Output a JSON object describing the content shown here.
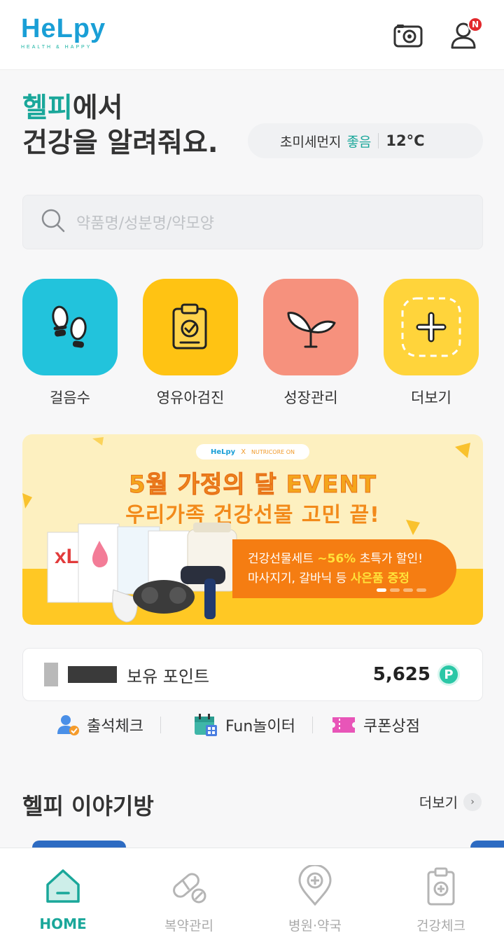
{
  "header": {
    "logo_text": "HeLpy",
    "logo_sub": "HEALTH & HAPPY",
    "icons": [
      "camera-icon",
      "user-icon"
    ],
    "notification_badge": "N"
  },
  "hero": {
    "line1_highlight": "헬피",
    "line1_rest": "에서",
    "line2": "건강을 알려줘요."
  },
  "weather": {
    "label": "초미세먼지",
    "status": "좋음",
    "temperature": "12°C"
  },
  "search": {
    "placeholder": "약품명/성분명/약모양"
  },
  "quick_menu": [
    {
      "label": "걸음수",
      "icon": "footprints-icon",
      "color": "#22c3dc"
    },
    {
      "label": "영유아검진",
      "icon": "clipboard-check-icon",
      "color": "#ffc313"
    },
    {
      "label": "성장관리",
      "icon": "sprout-icon",
      "color": "#f6917d"
    },
    {
      "label": "더보기",
      "icon": "plus-icon",
      "color": "#ffd43b"
    }
  ],
  "banner": {
    "logo_left": "HeLpy",
    "logo_x": "X",
    "logo_right": "NUTRICORE ON",
    "title1": "5월 가정의 달 EVENT",
    "title2": "우리가족 건강선물 고민 끝!",
    "pill_line1_a": "건강선물세트 ",
    "pill_line1_b": "~56%",
    "pill_line1_c": " 초특가 할인!",
    "pill_line2_a": "마사지기, 갈바닉 등 ",
    "pill_line2_b": "사은품 증정",
    "page_dots": 4,
    "active_dot": 0
  },
  "points": {
    "label": "보유 포인트",
    "value": "5,625",
    "badge": "P"
  },
  "links": [
    {
      "label": "출석체크",
      "icon": "attendance-icon"
    },
    {
      "label": "Fun놀이터",
      "icon": "calendar-icon"
    },
    {
      "label": "쿠폰상점",
      "icon": "coupon-icon"
    }
  ],
  "story": {
    "title": "헬피 이야기방",
    "more": "더보기",
    "more_arrow": "›"
  },
  "bottom_nav": [
    {
      "label": "HOME",
      "icon": "home-icon",
      "active": true
    },
    {
      "label": "복약관리",
      "icon": "pill-icon",
      "active": false
    },
    {
      "label": "병원·약국",
      "icon": "hospital-pin-icon",
      "active": false
    },
    {
      "label": "건강체크",
      "icon": "health-check-icon",
      "active": false
    }
  ]
}
